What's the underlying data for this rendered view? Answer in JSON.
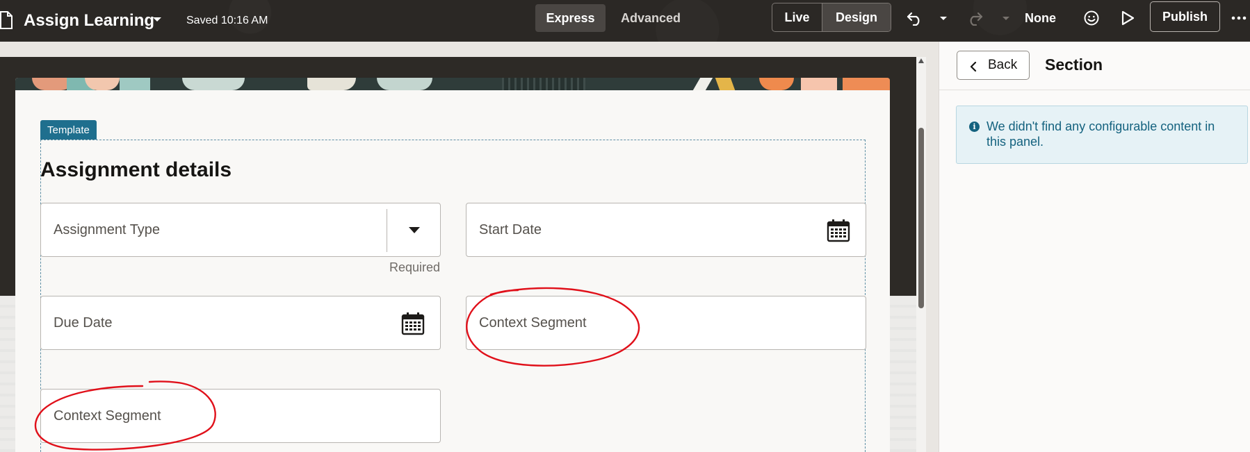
{
  "topbar": {
    "app_title": "Assign Learning",
    "saved_status": "Saved 10:16 AM",
    "mode_express": "Express",
    "mode_advanced": "Advanced",
    "view_live": "Live",
    "view_design": "Design",
    "none_label": "None",
    "publish_label": "Publish"
  },
  "canvas": {
    "template_tag": "Template",
    "section_title": "Assignment details",
    "fields": {
      "assignment_type": "Assignment Type",
      "assignment_type_helper": "Required",
      "start_date": "Start Date",
      "due_date": "Due Date",
      "context_segment_1": "Context Segment",
      "context_segment_2": "Context Segment"
    }
  },
  "panel": {
    "back_label": "Back",
    "title": "Section",
    "info_message": "We didn't find any configurable content in this panel."
  },
  "colors": {
    "topbar_bg": "#2b2825",
    "accent_teal": "#1f6f8e",
    "info_text": "#14627f",
    "annotation_red": "#e0101a"
  }
}
